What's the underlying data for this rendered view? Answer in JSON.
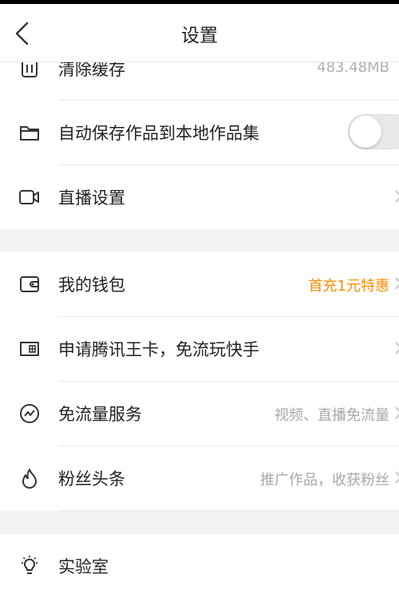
{
  "header": {
    "title": "设置"
  },
  "rows": {
    "clear_cache": {
      "label": "清除缓存",
      "value": "483.48MB"
    },
    "auto_save": {
      "label": "自动保存作品到本地作品集"
    },
    "live": {
      "label": "直播设置"
    },
    "wallet": {
      "label": "我的钱包",
      "value": "首充1元特惠"
    },
    "king_card": {
      "label": "申请腾讯王卡，免流玩快手"
    },
    "free_data": {
      "label": "免流量服务",
      "value": "视频、直播免流量"
    },
    "fans": {
      "label": "粉丝头条",
      "value": "推广作品，收获粉丝"
    },
    "lab": {
      "label": "实验室"
    }
  },
  "colors": {
    "accent": "#ff8b00",
    "muted": "#a8a8a8",
    "section_bg": "#f2f2f2"
  }
}
